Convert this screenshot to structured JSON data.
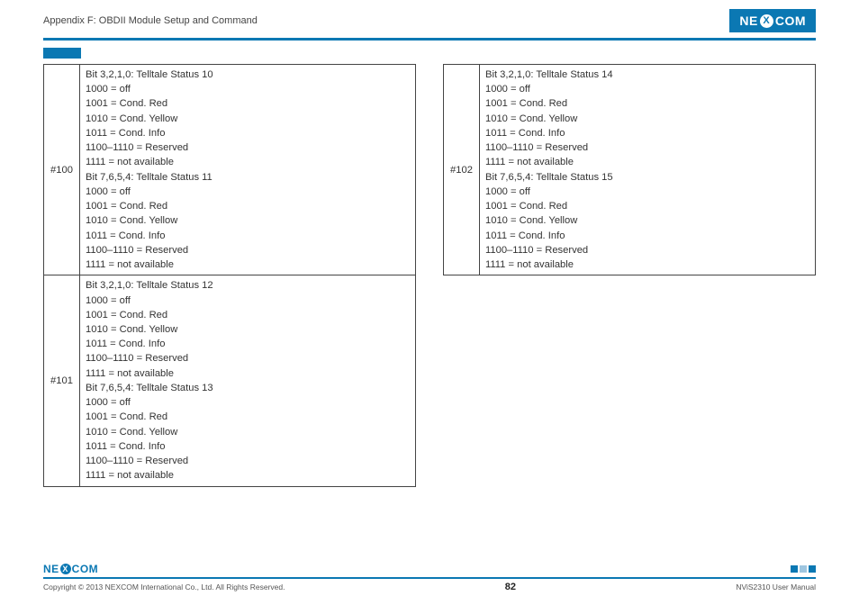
{
  "header": {
    "title": "Appendix F: OBDII Module Setup and Command",
    "logo_text_left": "NE",
    "logo_text_x": "X",
    "logo_text_right": "COM"
  },
  "rows": {
    "r100": {
      "id": "#100",
      "text": "Bit 3,2,1,0: Telltale Status 10\n1000 = off\n1001 = Cond. Red\n1010 = Cond. Yellow\n1011 = Cond. Info\n1100–1110 = Reserved\n1111 = not available\nBit 7,6,5,4: Telltale Status 11\n1000 = off\n1001 = Cond. Red\n1010 = Cond. Yellow\n1011 = Cond. Info\n1100–1110 = Reserved\n1111 = not available"
    },
    "r101": {
      "id": "#101",
      "text": "Bit 3,2,1,0: Telltale Status 12\n1000 = off\n1001 = Cond. Red\n1010 = Cond. Yellow\n1011 = Cond. Info\n1100–1110 = Reserved\n1111 = not available\nBit 7,6,5,4: Telltale Status 13\n1000 = off\n1001 = Cond. Red\n1010 = Cond. Yellow\n1011 = Cond. Info\n1100–1110 = Reserved\n1111 = not available"
    },
    "r102": {
      "id": "#102",
      "text": "Bit 3,2,1,0: Telltale Status 14\n1000 = off\n1001 = Cond. Red\n1010 = Cond. Yellow\n1011 = Cond. Info\n1100–1110 = Reserved\n1111 = not available\nBit 7,6,5,4: Telltale Status 15\n1000 = off\n1001 = Cond. Red\n1010 = Cond. Yellow\n1011 = Cond. Info\n1100–1110 = Reserved\n1111 = not available"
    }
  },
  "footer": {
    "copyright": "Copyright © 2013 NEXCOM International Co., Ltd. All Rights Reserved.",
    "page": "82",
    "manual": "NViS2310 User Manual",
    "logo_left": "NE",
    "logo_x": "X",
    "logo_right": "COM"
  }
}
